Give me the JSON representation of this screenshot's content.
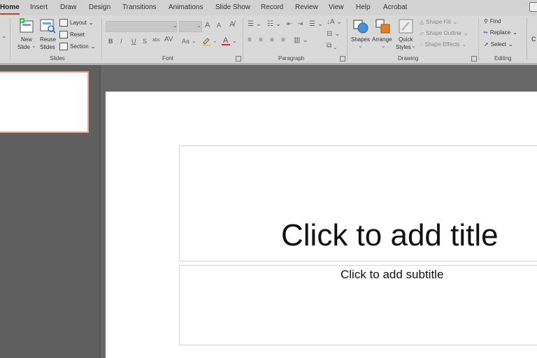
{
  "tabs": [
    "Home",
    "Insert",
    "Draw",
    "Design",
    "Transitions",
    "Animations",
    "Slide Show",
    "Record",
    "Review",
    "View",
    "Help",
    "Acrobat"
  ],
  "ribbon": {
    "slides": {
      "new_slide": "New",
      "new_slide_2": "Slide",
      "reuse": "Reuse",
      "reuse_2": "Slides",
      "layout": "Layout",
      "reset": "Reset",
      "section": "Section",
      "group": "Slides"
    },
    "font": {
      "group": "Font",
      "bold": "B",
      "italic": "I",
      "underline": "U",
      "strike": "S",
      "shadow": "abc",
      "case": "Aa",
      "spacing": "AV",
      "grow": "A",
      "shrink": "A"
    },
    "paragraph": {
      "group": "Paragraph"
    },
    "drawing": {
      "shapes": "Shapes",
      "arrange": "Arrange",
      "quick": "Quick",
      "styles": "Styles",
      "shape_fill": "Shape Fill",
      "shape_outline": "Shape Outline",
      "shape_effects": "Shape Effects",
      "group": "Drawing"
    },
    "editing": {
      "find": "Find",
      "replace": "Replace",
      "select": "Select",
      "group": "Editing"
    },
    "partial_right": "C"
  },
  "slide": {
    "title_placeholder": "Click to add title",
    "subtitle_placeholder": "Click to add subtitle"
  },
  "colors": {
    "accent": "#b7472a",
    "thumb_border": "#e8a89a"
  }
}
